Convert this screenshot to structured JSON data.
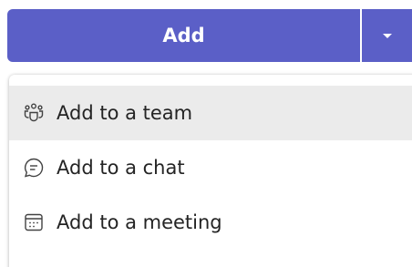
{
  "split_button": {
    "label": "Add",
    "dropdown_icon": "chevron-down-icon",
    "accent": "#5b5fc7"
  },
  "menu": {
    "items": [
      {
        "label": "Add to a team",
        "icon": "team-icon"
      },
      {
        "label": "Add to a chat",
        "icon": "chat-icon"
      },
      {
        "label": "Add to a meeting",
        "icon": "calendar-icon"
      }
    ],
    "highlight_color": "#ebebeb"
  }
}
